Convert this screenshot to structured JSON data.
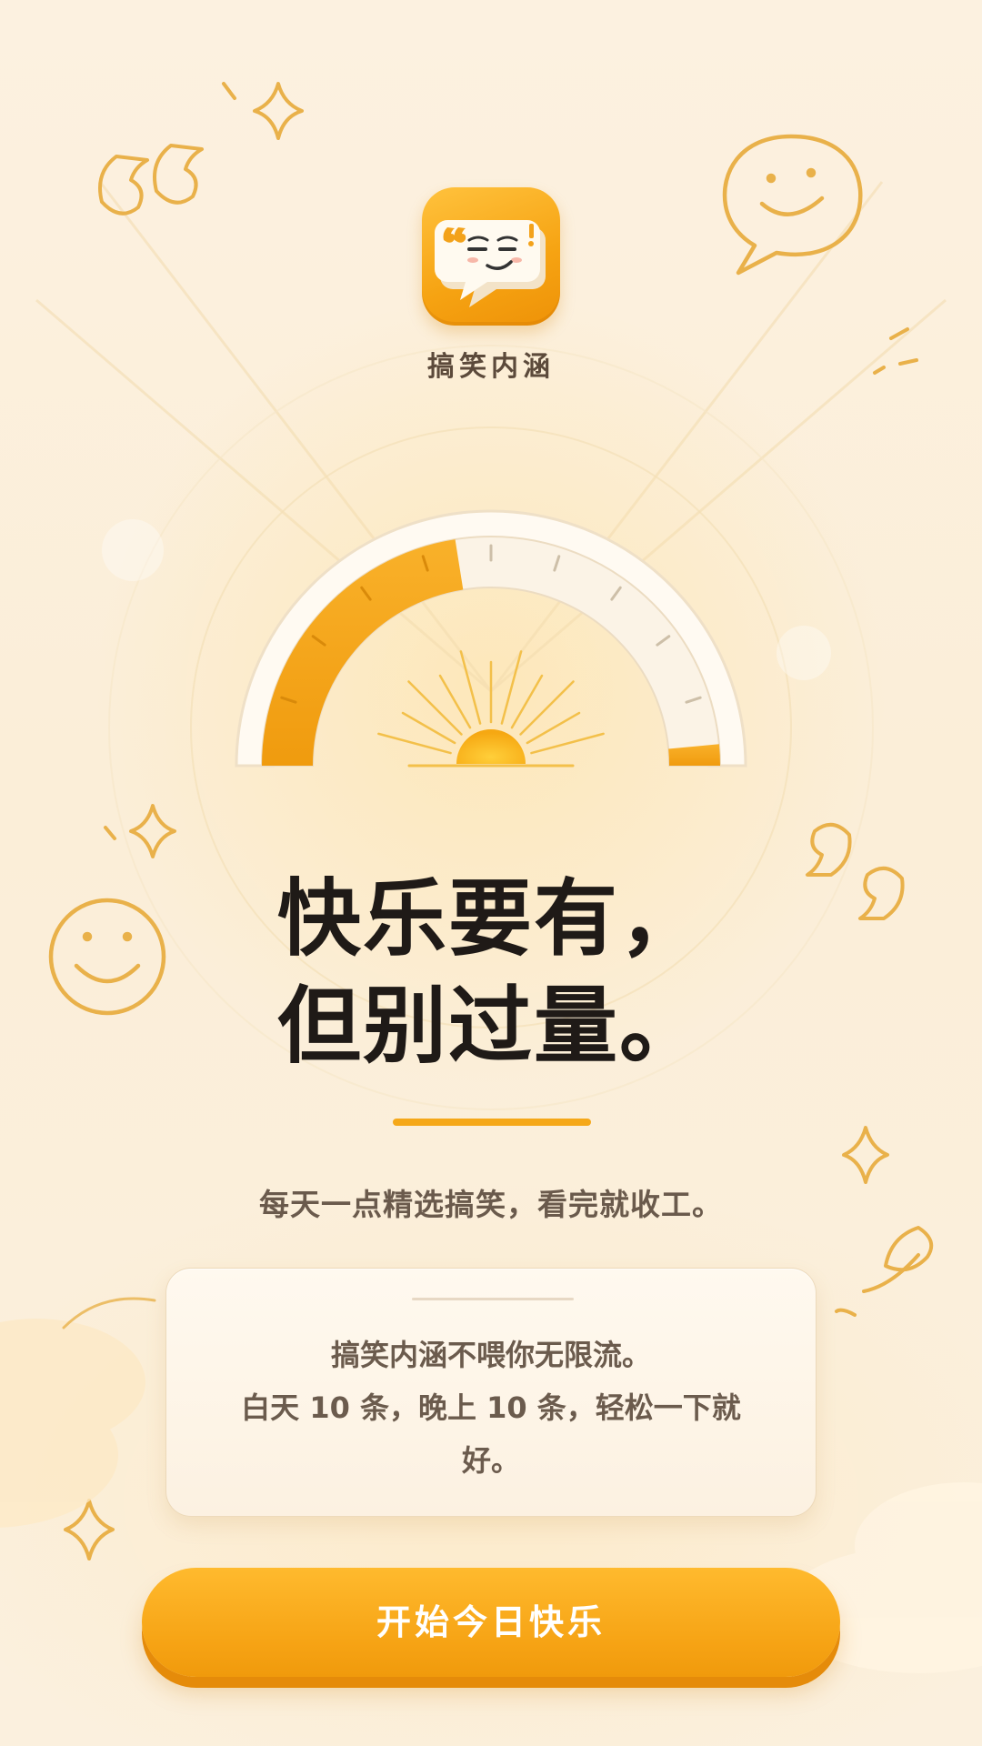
{
  "app": {
    "name": "搞笑内涵"
  },
  "gauge": {
    "fill_fraction": 0.45,
    "secondary_fill_fraction": 0.03
  },
  "headline": {
    "line1": "快乐要有，",
    "line2": "但别过量。"
  },
  "subtitle": "每天一点精选搞笑，看完就收工。",
  "card": {
    "line1": "搞笑内涵不喂你无限流。",
    "line2": "白天 10 条，晚上 10 条，轻松一下就",
    "line3": "好。"
  },
  "cta": {
    "label": "开始今日快乐"
  },
  "colors": {
    "accent": "#f6a314",
    "background": "#fbf0df",
    "headline": "#1f1a17",
    "body_text": "#6b5b4d",
    "deco_stroke": "#e9b14a"
  },
  "icons": {
    "app_logo": "speech-bubble-face-icon",
    "decorations": [
      "quote-open-icon",
      "quote-close-icon",
      "smiley-bubble-icon",
      "smiley-face-icon",
      "sparkle-icon",
      "sun-icon",
      "leaf-icon",
      "cloud-icon"
    ]
  }
}
